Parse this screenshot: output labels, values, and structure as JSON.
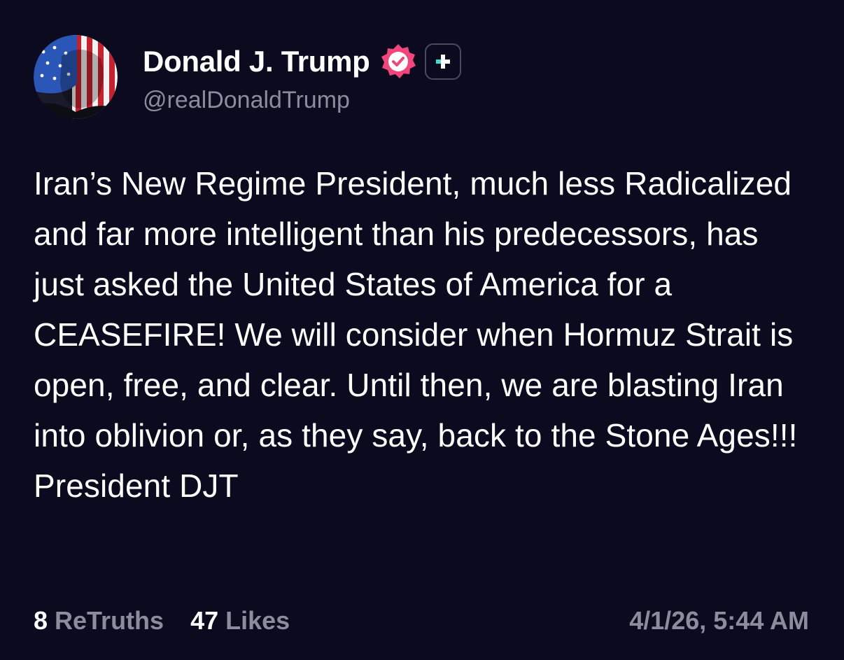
{
  "author": {
    "display_name": "Donald J. Trump",
    "handle": "@realDonaldTrump",
    "verified_icon": "verified-badge-icon",
    "follow_icon": "plus-icon",
    "avatar": "avatar-image"
  },
  "post": {
    "text": "Iran’s New Regime President, much less Radicalized and far more intelligent than his predecessors, has just asked the United States of America for a CEASEFIRE! We will consider when Hormuz Strait is open, free, and clear. Until then, we are blasting Iran into oblivion or, as they say, back to the Stone Ages!!! President DJT"
  },
  "stats": {
    "retruths_count": "8",
    "retruths_label": "ReTruths",
    "likes_count": "47",
    "likes_label": "Likes"
  },
  "timestamp": "4/1/26, 5:44 AM",
  "colors": {
    "background": "#0b0a1e",
    "verified_badge": "#f2467a",
    "follow_accent": "#3fe0c5",
    "muted_text": "#8c8c9e"
  }
}
